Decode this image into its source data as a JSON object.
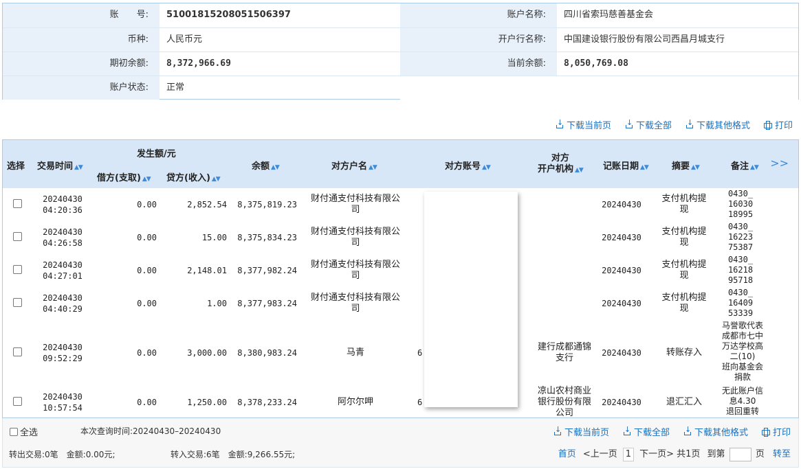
{
  "account_info": {
    "account_no_label": "账　　号:",
    "account_no": "51001815208051506397",
    "account_name_label": "账户名称:",
    "account_name": "四川省索玛慈善基金会",
    "currency_label": "币种:",
    "currency": "人民币元",
    "bank_label": "开户行名称:",
    "bank": "中国建设银行股份有限公司西昌月城支行",
    "opening_balance_label": "期初余额:",
    "opening_balance": "8,372,966.69",
    "current_balance_label": "当前余额:",
    "current_balance": "8,050,769.08",
    "status_label": "账户状态:",
    "status": "正常"
  },
  "toolbar": {
    "download_page": "下载当前页",
    "download_all": "下载全部",
    "download_other": "下载其他格式",
    "print": "打印"
  },
  "table": {
    "headers": {
      "select": "选择",
      "time": "交易时间",
      "amount_group": "发生额/元",
      "debit": "借方(支取)",
      "credit": "贷方(收入)",
      "balance": "余额",
      "counterparty_name": "对方户名",
      "counterparty_account": "对方账号",
      "counterparty_bank_1": "对方",
      "counterparty_bank_2": "开户机构",
      "booking_date": "记账日期",
      "summary": "摘要",
      "remark": "备注",
      "more": ">>"
    },
    "rows": [
      {
        "date": "20240430",
        "time": "04:20:36",
        "debit": "0.00",
        "credit": "2,852.54",
        "balance": "8,375,819.23",
        "name_1": "财付通支付科技有限公",
        "name_2": "司",
        "account": "",
        "bank": "",
        "book_date": "20240430",
        "summary_1": "支付机构提",
        "summary_2": "现",
        "remark": [
          "0430_",
          "16030",
          "18995"
        ]
      },
      {
        "date": "20240430",
        "time": "04:26:58",
        "debit": "0.00",
        "credit": "15.00",
        "balance": "8,375,834.23",
        "name_1": "财付通支付科技有限公",
        "name_2": "司",
        "account": "",
        "bank": "",
        "book_date": "20240430",
        "summary_1": "支付机构提",
        "summary_2": "现",
        "remark": [
          "0430_",
          "16223",
          "75387"
        ]
      },
      {
        "date": "20240430",
        "time": "04:27:01",
        "debit": "0.00",
        "credit": "2,148.01",
        "balance": "8,377,982.24",
        "name_1": "财付通支付科技有限公",
        "name_2": "司",
        "account": "",
        "bank": "",
        "book_date": "20240430",
        "summary_1": "支付机构提",
        "summary_2": "现",
        "remark": [
          "0430_",
          "16218",
          "95718"
        ]
      },
      {
        "date": "20240430",
        "time": "04:40:29",
        "debit": "0.00",
        "credit": "1.00",
        "balance": "8,377,983.24",
        "name_1": "财付通支付科技有限公",
        "name_2": "司",
        "account": "",
        "bank": "",
        "book_date": "20240430",
        "summary_1": "支付机构提",
        "summary_2": "现",
        "remark": [
          "0430_",
          "16409",
          "53339"
        ]
      },
      {
        "date": "20240430",
        "time": "09:52:29",
        "debit": "0.00",
        "credit": "3,000.00",
        "balance": "8,380,983.24",
        "name_1": "马青",
        "name_2": "",
        "account": "6:",
        "bank_1": "建行成都通锦",
        "bank_2": "支行",
        "book_date": "20240430",
        "summary_1": "转账存入",
        "summary_2": "",
        "remark": [
          "马誉歌代表",
          "成都市七中",
          "万达学校高",
          "二(10)",
          "班向基金会",
          "捐款"
        ]
      },
      {
        "date": "20240430",
        "time": "10:57:54",
        "debit": "0.00",
        "credit": "1,250.00",
        "balance": "8,378,233.24",
        "name_1": "阿尔尔呷",
        "name_2": "",
        "account": "6:",
        "bank_1": "凉山农村商业",
        "bank_2": "银行股份有限",
        "bank_3": "公司",
        "book_date": "20240430",
        "summary_1": "退汇汇入",
        "summary_2": "",
        "remark": [
          "无此账户信",
          "息4.30",
          "退回重转"
        ]
      }
    ]
  },
  "footer": {
    "select_all": "全选",
    "query_time": "本次查询时间:20240430–20240430",
    "out_summary": "转出交易:0笔　金额:0.00元;",
    "in_summary": "转入交易:6笔　金额:9,266.55元;",
    "pager": {
      "first": "首页",
      "prev": "<上一页",
      "current": "1",
      "next": "下一页>",
      "total": "共1页",
      "goto_prefix": "到第",
      "goto_suffix": "页",
      "go": "转至"
    }
  }
}
